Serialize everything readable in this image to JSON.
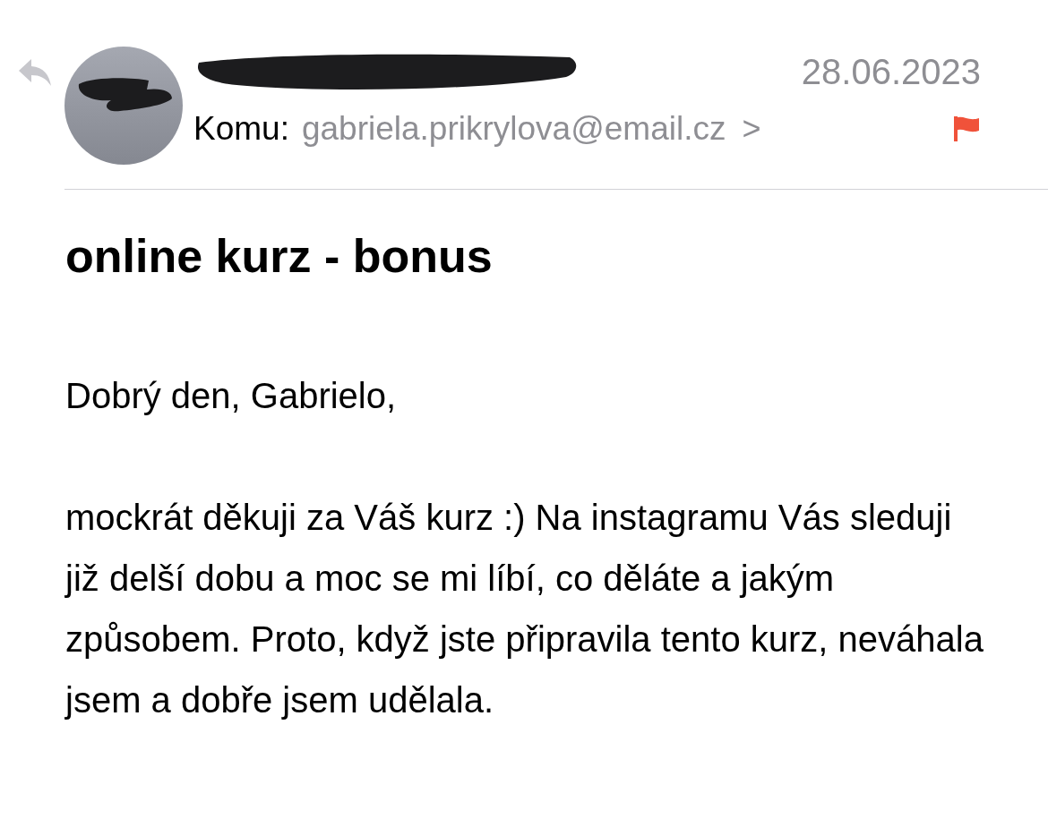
{
  "header": {
    "recipient_label": "Komu:",
    "recipient": "gabriela.prikrylova@email.cz",
    "chevron": ">",
    "date": "28.06.2023",
    "flagged": true,
    "replied": true
  },
  "subject": "online kurz - bonus",
  "body": [
    "Dobrý den, Gabrielo,",
    "mockrát děkuji za Váš kurz :) Na instagramu Vás sleduji již delší dobu a moc se mi líbí, co děláte a jakým způsobem. Proto, když jste připravila tento kurz, neváhala jsem a dobře jsem udělala."
  ]
}
